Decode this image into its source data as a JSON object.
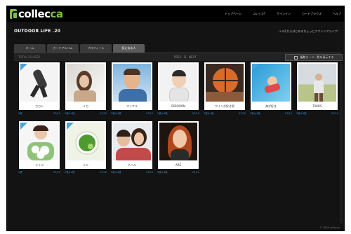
{
  "app": {
    "logo_main": "collec",
    "logo_accent": "ca"
  },
  "topnav": [
    "トップページ",
    "コレッカ?",
    "サインイン",
    "カードブラウズ",
    "ヘルプ"
  ],
  "page": {
    "title": "OUTDOOR LIFE .20",
    "tagline": "ハヨそからはじめるちょっとアウトドアライフ!"
  },
  "tabs": [
    {
      "label": "ホーム",
      "active": false
    },
    {
      "label": "カードアルバム",
      "active": false
    },
    {
      "label": "プロフィール",
      "active": false
    },
    {
      "label": "気になる人",
      "active": true
    }
  ],
  "subbar": {
    "total": "TOTAL 35 USER",
    "pager_prev": "PREV",
    "pager_current": "1",
    "pager_next": "NEXT",
    "bulk_label": "複数カード一覧を表示する"
  },
  "cards": [
    {
      "name": "カカシ",
      "meta_left": "2枚",
      "meta_right": "07/10",
      "corner": true,
      "theme": "jump"
    },
    {
      "name": "ミカ",
      "meta_left": "2枚★4枚",
      "meta_right": "07/10",
      "corner": false,
      "theme": "woman-hand"
    },
    {
      "name": "マイケル",
      "meta_left": "2枚★4枚",
      "meta_right": "07/10",
      "corner": false,
      "theme": "man-sky"
    },
    {
      "name": "DIDOOON",
      "meta_left": "2枚★4枚",
      "meta_right": "07/10",
      "corner": false,
      "theme": "baby"
    },
    {
      "name": "ワインが好き男",
      "meta_left": "2枚★4枚",
      "meta_right": "07/10",
      "corner": false,
      "theme": "ball"
    },
    {
      "name": "海が好き",
      "meta_left": "2枚★4枚",
      "meta_right": "07/10",
      "corner": true,
      "theme": "pool"
    },
    {
      "name": "TAKOS",
      "meta_left": "2枚★4枚",
      "meta_right": "07/10",
      "corner": false,
      "theme": "field"
    },
    {
      "name": "ライコ",
      "meta_left": "2枚",
      "meta_right": "07/10",
      "corner": true,
      "theme": "flowers"
    },
    {
      "name": "ミニ",
      "meta_left": "2枚★4枚",
      "meta_right": "07/10",
      "corner": true,
      "theme": "tea"
    },
    {
      "name": "チハル",
      "meta_left": "2枚★4枚",
      "meta_right": "07/10",
      "corner": false,
      "theme": "couple"
    },
    {
      "name": "ARS",
      "meta_left": "2枚★4枚",
      "meta_right": "07/10",
      "corner": false,
      "theme": "redhair"
    }
  ],
  "footer": "© 2008 collecca"
}
